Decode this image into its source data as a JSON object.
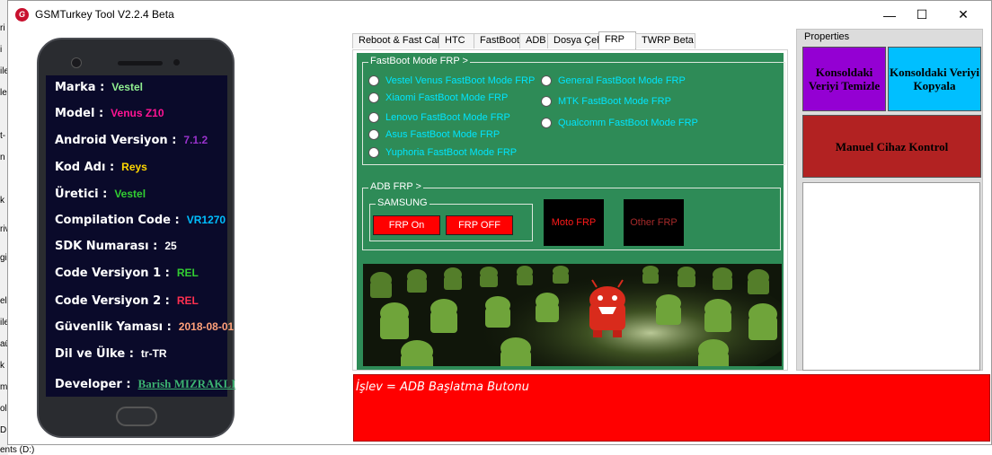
{
  "window": {
    "title": "GSMTurkey Tool V2.2.4 Beta",
    "icon": "gsm-app-icon",
    "controls": {
      "minimize": "—",
      "maximize": "☐",
      "close": "✕"
    }
  },
  "desktop_fragments": {
    "items": [
      "ri",
      "i",
      "ile",
      "lel",
      "t-",
      "n",
      "k",
      "riv",
      "gi",
      "el",
      "ile",
      "aü",
      "k",
      "m",
      "ol",
      "D"
    ],
    "bottom": "ents (D:)"
  },
  "device_info": [
    {
      "label": "Marka :",
      "value": "Vestel",
      "color": "#90ee90"
    },
    {
      "label": "Model :",
      "value": "Venus Z10",
      "color": "#ff1493"
    },
    {
      "label": "Android Versiyon :",
      "value": "7.1.2",
      "color": "#9932cc"
    },
    {
      "label": "Kod Adı :",
      "value": "Reys",
      "color": "#ffd700"
    },
    {
      "label": "Üretici :",
      "value": "Vestel",
      "color": "#32cd32"
    },
    {
      "label": "Compilation Code :",
      "value": "VR1270",
      "color": "#00bfff"
    },
    {
      "label": "SDK Numarası :",
      "value": "25",
      "color": "#ffffff"
    },
    {
      "label": "Code Versiyon 1 :",
      "value": "REL",
      "color": "#32cd32"
    },
    {
      "label": "Code Versiyon 2 :",
      "value": "REL",
      "color": "#ff3050"
    },
    {
      "label": "Güvenlik Yaması :",
      "value": "2018-08-01",
      "color": "#ffa07a"
    },
    {
      "label": "Dil ve Ülke :",
      "value": "tr-TR",
      "color": "#ffffff"
    },
    {
      "label": "Developer :",
      "value": "Barish MIZRAKLI",
      "color": "#3cb371"
    }
  ],
  "tabs": [
    "Reboot & Fast Call",
    "HTC",
    "FastBoot",
    "ADB",
    "Dosya Çek",
    "FRP",
    "TWRP Beta"
  ],
  "active_tab": "FRP",
  "frp": {
    "fastboot_group_title": "FastBoot Mode FRP >",
    "fastboot_left": [
      "Vestel Venus FastBoot Mode FRP",
      "Xiaomi FastBoot Mode FRP",
      "Lenovo FastBoot Mode FRP",
      "Asus FastBoot Mode FRP",
      "Yuphoria FastBoot Mode FRP"
    ],
    "fastboot_right": [
      "General FastBoot Mode FRP",
      "MTK FastBoot Mode FRP",
      "Qualcomm FastBoot Mode FRP"
    ],
    "adb_group_title": "ADB FRP >",
    "samsung_group_title": "SAMSUNG",
    "frp_on": "FRP On",
    "frp_off": "FRP OFF",
    "moto_frp": "Moto FRP",
    "other_frp": "Other FRP"
  },
  "console": {
    "text": "İşlev = ADB Başlatma Butonu"
  },
  "properties": {
    "title": "Properties",
    "clear_button": "Konsoldaki Veriyi Temizle",
    "copy_button": "Konsoldaki Veriyi Kopyala",
    "manual_button": "Manuel Cihaz Kontrol",
    "colors": {
      "clear": "#9400d3",
      "copy": "#00bfff",
      "manual": "#b22222"
    }
  }
}
